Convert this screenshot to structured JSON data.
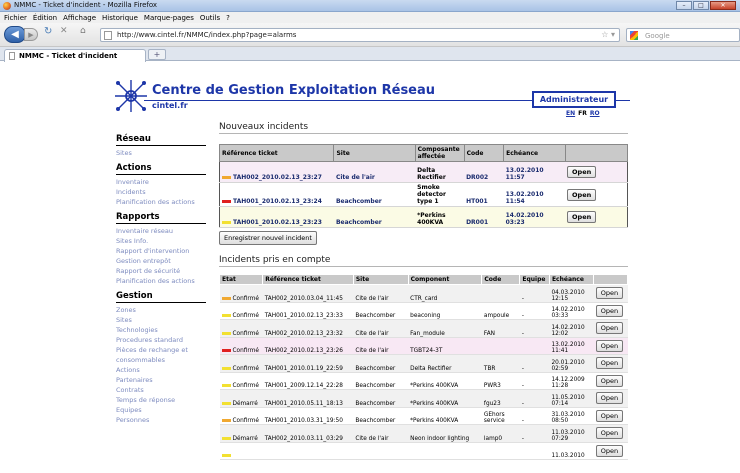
{
  "window": {
    "title": "NMMC - Ticket d'incident - Mozilla Firefox",
    "controls": [
      "–",
      "□",
      "✕"
    ]
  },
  "menu": [
    "Fichier",
    "Édition",
    "Affichage",
    "Historique",
    "Marque-pages",
    "Outils",
    "?"
  ],
  "address": {
    "url": "http://www.cintel.fr/NMMC/index.php?page=alarms",
    "search_placeholder": "Google"
  },
  "tab": {
    "title": "NMMC - Ticket d'incident",
    "new_tab": "+"
  },
  "header": {
    "title": "Centre de Gestion Exploitation Réseau",
    "subtitle": "cintel.fr",
    "role": "Administrateur",
    "langs": [
      "EN",
      "FR",
      "RO"
    ]
  },
  "sidebar": [
    {
      "title": "Réseau",
      "items": [
        "Sites"
      ]
    },
    {
      "title": "Actions",
      "items": [
        "Inventaire",
        "Incidents",
        "Planification des actions"
      ]
    },
    {
      "title": "Rapports",
      "items": [
        "Inventaire réseau",
        "Sites Info.",
        "Rapport d'intervention",
        "Gestion entrepôt",
        "Rapport de sécurité",
        "Planification des actions"
      ]
    },
    {
      "title": "Gestion",
      "items": [
        "Zones",
        "Sites",
        "Technologies",
        "Procedures standard",
        "Pièces de rechange et consommables",
        "Actions",
        "Partenaires",
        "Contrats",
        "Temps de réponse",
        "Equipes",
        "Personnes"
      ]
    }
  ],
  "new_incidents": {
    "title": "Nouveaux incidents",
    "headers": [
      "Référence ticket",
      "Site",
      "Composante affectée",
      "Code",
      "Echéance",
      ""
    ],
    "rows": [
      {
        "color": "#f0a830",
        "ref": "TAH002_2010.02.13_23:27",
        "site": "Cite de l'air",
        "component": "Delta Rectifier",
        "code": "DR002",
        "deadline": "13.02.2010 11:57",
        "action": "Open"
      },
      {
        "color": "#e02020",
        "ref": "TAH001_2010.02.13_23:24",
        "site": "Beachcomber",
        "component": "Smoke detector type 1",
        "code": "HT001",
        "deadline": "13.02.2010 11:54",
        "action": "Open"
      },
      {
        "color": "#f2e030",
        "ref": "TAH001_2010.02.13_23:23",
        "site": "Beachcomber",
        "component": "*Perkins 400KVA",
        "code": "DR001",
        "deadline": "14.02.2010 03:23",
        "action": "Open"
      }
    ],
    "register_button": "Enregistrer nouvel incident"
  },
  "taken_incidents": {
    "title": "Incidents pris en compte",
    "headers": [
      "Etat",
      "Référence ticket",
      "Site",
      "Component",
      "Code",
      "Equipe",
      "Echéance",
      ""
    ],
    "rows": [
      {
        "color": "#f0a830",
        "state": "Confirmé",
        "ref": "TAH002_2010.03.04_11:45",
        "site": "Cite de l'air",
        "component": "CTR_card",
        "code": "",
        "team": "-",
        "deadline": "04.03.2010 12:15",
        "action": "Open"
      },
      {
        "color": "#f2e030",
        "state": "Confirmé",
        "ref": "TAH001_2010.02.13_23:33",
        "site": "Beachcomber",
        "component": "beaconing",
        "code": "ampoule",
        "team": "-",
        "deadline": "14.02.2010 03:33",
        "action": "Open"
      },
      {
        "color": "#f2e030",
        "state": "Confirmé",
        "ref": "TAH002_2010.02.13_23:32",
        "site": "Cite de l'air",
        "component": "Fan_module",
        "code": "FAN",
        "team": "-",
        "deadline": "14.02.2010 12:02",
        "action": "Open"
      },
      {
        "color": "#e02020",
        "state": "Confirmé",
        "ref": "TAH002_2010.02.13_23:26",
        "site": "Cite de l'air",
        "component": "TGBT24-3T",
        "code": "",
        "team": "",
        "deadline": "13.02.2010 11:41",
        "action": "Open"
      },
      {
        "color": "#f2e030",
        "state": "Confirmé",
        "ref": "TAH001_2010.01.19_22:59",
        "site": "Beachcomber",
        "component": "Delta Rectifier",
        "code": "TBR",
        "team": "-",
        "deadline": "20.01.2010 02:59",
        "action": "Open"
      },
      {
        "color": "#f2e030",
        "state": "Confirmé",
        "ref": "TAH001_2009.12.14_22:28",
        "site": "Beachcomber",
        "component": "*Perkins 400KVA",
        "code": "PWR3",
        "team": "-",
        "deadline": "14.12.2009 11:28",
        "action": "Open"
      },
      {
        "color": "#f2e030",
        "state": "Démarré",
        "ref": "TAH001_2010.05.11_18:13",
        "site": "Beachcomber",
        "component": "*Perkins 400KVA",
        "code": "fgu23",
        "team": "-",
        "deadline": "11.05.2010 07:14",
        "action": "Open"
      },
      {
        "color": "#f0a830",
        "state": "Confirmé",
        "ref": "TAH001_2010.03.31_19:50",
        "site": "Beachcomber",
        "component": "*Perkins 400KVA",
        "code": "GEhors service",
        "team": "-",
        "deadline": "31.03.2010 08:50",
        "action": "Open"
      },
      {
        "color": "#f2e030",
        "state": "Démarré",
        "ref": "TAH002_2010.03.11_03:29",
        "site": "Cite de l'air",
        "component": "Neon indoor lighting",
        "code": "lamp0",
        "team": "-",
        "deadline": "11.03.2010 07:29",
        "action": "Open"
      },
      {
        "color": "#f2e030",
        "state": "",
        "ref": "",
        "site": "",
        "component": "",
        "code": "",
        "team": "",
        "deadline": "11.03.2010",
        "action": "Open"
      }
    ]
  }
}
